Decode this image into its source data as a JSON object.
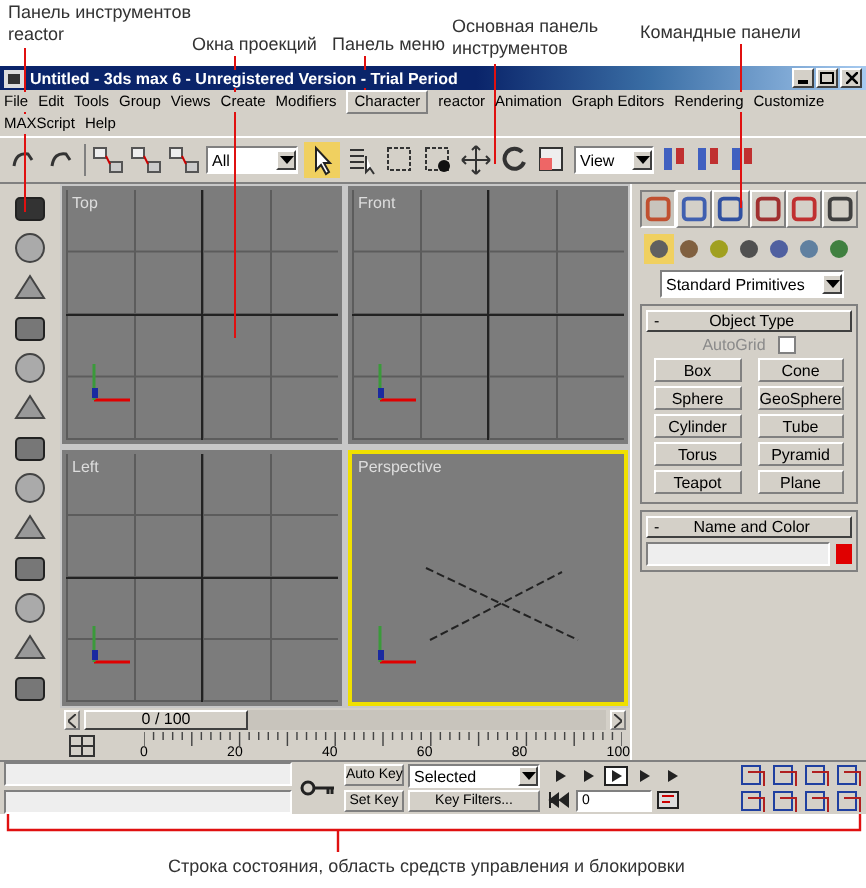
{
  "annotations": [
    {
      "text": "Панель инструментов reactor"
    },
    {
      "text": "Окна проекций"
    },
    {
      "text": "Панель меню"
    },
    {
      "text": "Основная панель инструментов"
    },
    {
      "text": "Командные панели"
    },
    {
      "text": "Строка состояния, область средств управления и блокировки"
    }
  ],
  "window": {
    "title": "Untitled - 3ds max 6 - Unregistered Version - Trial Period"
  },
  "menu": [
    {
      "label": "File",
      "selected": false
    },
    {
      "label": "Edit",
      "selected": false
    },
    {
      "label": "Tools",
      "selected": false
    },
    {
      "label": "Group",
      "selected": false
    },
    {
      "label": "Views",
      "selected": false
    },
    {
      "label": "Create",
      "selected": false
    },
    {
      "label": "Modifiers",
      "selected": false
    },
    {
      "label": "Character",
      "selected": true
    },
    {
      "label": "reactor",
      "selected": false
    },
    {
      "label": "Animation",
      "selected": false
    },
    {
      "label": "Graph Editors",
      "selected": false
    },
    {
      "label": "Rendering",
      "selected": false
    },
    {
      "label": "Customize",
      "selected": false
    },
    {
      "label": "MAXScript",
      "selected": false
    },
    {
      "label": "Help",
      "selected": false
    }
  ],
  "toolbar": {
    "selection_filter": "All",
    "reference_coord": "View",
    "select_active": true
  },
  "viewports": [
    {
      "label": "Top",
      "selected": false
    },
    {
      "label": "Front",
      "selected": false
    },
    {
      "label": "Left",
      "selected": false
    },
    {
      "label": "Perspective",
      "selected": true
    }
  ],
  "command_panel": {
    "tabs": [
      {
        "kind": "create",
        "selected": true
      },
      {
        "kind": "modify",
        "selected": false
      },
      {
        "kind": "hierarchy",
        "selected": false
      },
      {
        "kind": "motion",
        "selected": false
      },
      {
        "kind": "display",
        "selected": false
      },
      {
        "kind": "utilities",
        "selected": false
      }
    ],
    "categories": [
      {
        "kind": "geometry",
        "selected": true
      },
      {
        "kind": "shapes",
        "selected": false
      },
      {
        "kind": "lights",
        "selected": false
      },
      {
        "kind": "cameras",
        "selected": false
      },
      {
        "kind": "helpers",
        "selected": false
      },
      {
        "kind": "spacewarps",
        "selected": false
      },
      {
        "kind": "systems",
        "selected": false
      }
    ],
    "category": "Standard Primitives",
    "object_type": {
      "sign": "-",
      "title": "Object Type",
      "autogrid": {
        "label": "AutoGrid",
        "checked": false,
        "disabled": true
      },
      "buttons": [
        "Box",
        "Cone",
        "Sphere",
        "GeoSphere",
        "Cylinder",
        "Tube",
        "Torus",
        "Pyramid",
        "Teapot",
        "Plane"
      ]
    },
    "name_and_color": {
      "sign": "-",
      "title": "Name and Color",
      "color": "#e00000"
    }
  },
  "time_slider": {
    "label": "0 / 100",
    "level": 0
  },
  "track_bar": {
    "ticks": [
      "0",
      "20",
      "40",
      "60",
      "80",
      "100"
    ]
  },
  "status": {
    "auto_key": "Auto Key",
    "set_key": "Set Key",
    "key_mode": "Selected",
    "key_filters": "Key Filters...",
    "frame": "0"
  }
}
